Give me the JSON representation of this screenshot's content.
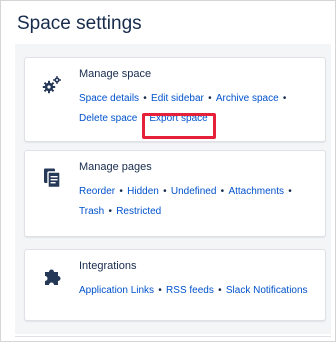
{
  "page": {
    "title": "Space settings"
  },
  "cards": [
    {
      "title": "Manage space",
      "icon": "gears-icon",
      "links": [
        "Space details",
        "Edit sidebar",
        "Archive space",
        "Delete space",
        "Export space"
      ],
      "highlighted": "Export space"
    },
    {
      "title": "Manage pages",
      "icon": "pages-icon",
      "links": [
        "Reorder",
        "Hidden",
        "Undefined",
        "Attachments",
        "Trash",
        "Restricted"
      ]
    },
    {
      "title": "Integrations",
      "icon": "puzzle-icon",
      "links": [
        "Application Links",
        "RSS feeds",
        "Slack Notifications"
      ]
    }
  ],
  "colors": {
    "link": "#0052cc",
    "highlight": "#e5213a",
    "panel_bg": "#f4f5f7"
  }
}
